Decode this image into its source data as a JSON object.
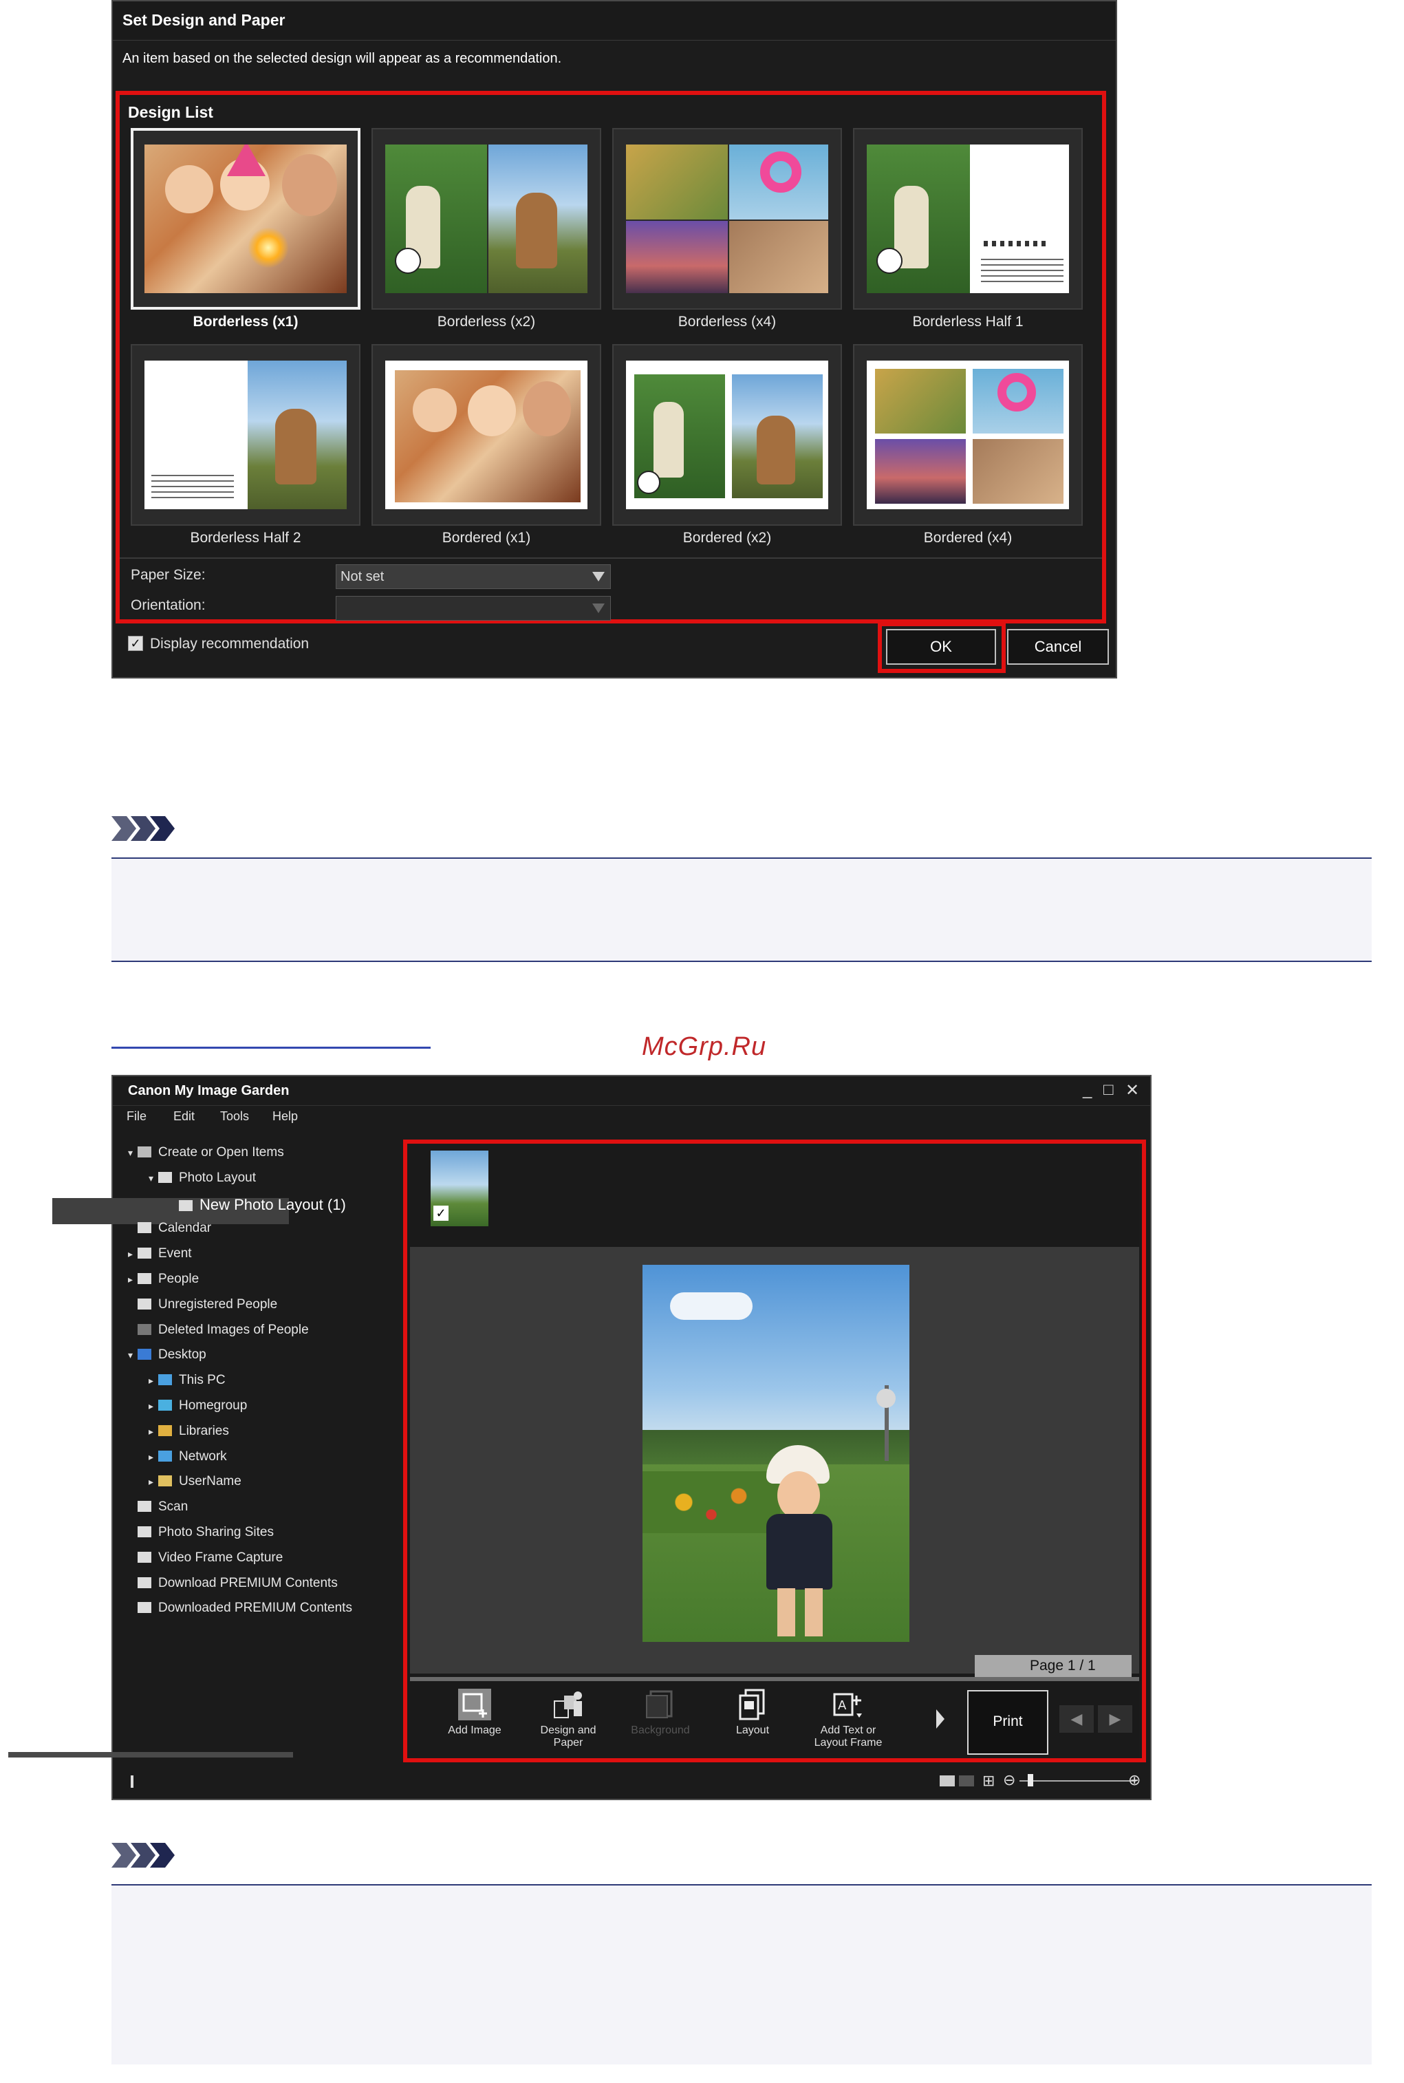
{
  "dialog": {
    "title": "Set Design and Paper",
    "description": "An item based on the selected design will appear as a recommendation.",
    "design_list_label": "Design List",
    "designs": [
      {
        "label": "Borderless (x1)",
        "selected": true
      },
      {
        "label": "Borderless (x2)",
        "selected": false
      },
      {
        "label": "Borderless (x4)",
        "selected": false
      },
      {
        "label": "Borderless Half 1",
        "selected": false
      },
      {
        "label": "Borderless Half 2",
        "selected": false
      },
      {
        "label": "Bordered (x1)",
        "selected": false
      },
      {
        "label": "Bordered (x2)",
        "selected": false
      },
      {
        "label": "Bordered (x4)",
        "selected": false
      }
    ],
    "paper_size_label": "Paper Size:",
    "paper_size_value": "Not set",
    "orientation_label": "Orientation:",
    "orientation_value": "",
    "display_recommendation_label": "Display recommendation",
    "display_recommendation_checked": true,
    "ok_label": "OK",
    "cancel_label": "Cancel",
    "highlight_color": "#e01010"
  },
  "watermark": "McGrp.Ru",
  "app": {
    "title": "Canon My Image Garden",
    "window_controls": [
      "_",
      "□",
      "✕"
    ],
    "menu": [
      "File",
      "Edit",
      "Tools",
      "Help"
    ],
    "tree": [
      {
        "label": "Create or Open Items",
        "level": 0,
        "toggle": "▾",
        "icon": "create-items-icon"
      },
      {
        "label": "Photo Layout",
        "level": 1,
        "toggle": "▾",
        "icon": "photo-layout-icon"
      },
      {
        "label": "New Photo Layout (1)",
        "level": 2,
        "toggle": "",
        "icon": "layout-item-icon",
        "selected": true
      },
      {
        "label": "Calendar",
        "level": 0,
        "toggle": "",
        "icon": "calendar-icon"
      },
      {
        "label": "Event",
        "level": 0,
        "toggle": "▸",
        "icon": "event-icon"
      },
      {
        "label": "People",
        "level": 0,
        "toggle": "▸",
        "icon": "people-icon"
      },
      {
        "label": "Unregistered People",
        "level": 0,
        "toggle": "",
        "icon": "unregistered-people-icon"
      },
      {
        "label": "Deleted Images of People",
        "level": 0,
        "toggle": "",
        "icon": "deleted-people-icon"
      },
      {
        "label": "Desktop",
        "level": 0,
        "toggle": "▾",
        "icon": "desktop-icon"
      },
      {
        "label": "This PC",
        "level": 1,
        "toggle": "▸",
        "icon": "this-pc-icon"
      },
      {
        "label": "Homegroup",
        "level": 1,
        "toggle": "▸",
        "icon": "homegroup-icon"
      },
      {
        "label": "Libraries",
        "level": 1,
        "toggle": "▸",
        "icon": "libraries-icon"
      },
      {
        "label": "Network",
        "level": 1,
        "toggle": "▸",
        "icon": "network-icon"
      },
      {
        "label": "UserName",
        "level": 1,
        "toggle": "▸",
        "icon": "user-folder-icon"
      },
      {
        "label": "Scan",
        "level": 0,
        "toggle": "",
        "icon": "scan-icon"
      },
      {
        "label": "Photo Sharing Sites",
        "level": 0,
        "toggle": "",
        "icon": "photo-sharing-icon"
      },
      {
        "label": "Video Frame Capture",
        "level": 0,
        "toggle": "",
        "icon": "video-frame-icon"
      },
      {
        "label": "Download PREMIUM Contents",
        "level": 0,
        "toggle": "",
        "icon": "download-icon"
      },
      {
        "label": "Downloaded PREMIUM Contents",
        "level": 0,
        "toggle": "",
        "icon": "folder-icon"
      }
    ],
    "page_indicator": "Page 1 / 1",
    "toolbar": {
      "add_image": "Add Image",
      "design_and_paper": "Design and Paper",
      "background": "Background",
      "layout": "Layout",
      "add_text": "Add Text or Layout Frame",
      "print": "Print"
    }
  }
}
